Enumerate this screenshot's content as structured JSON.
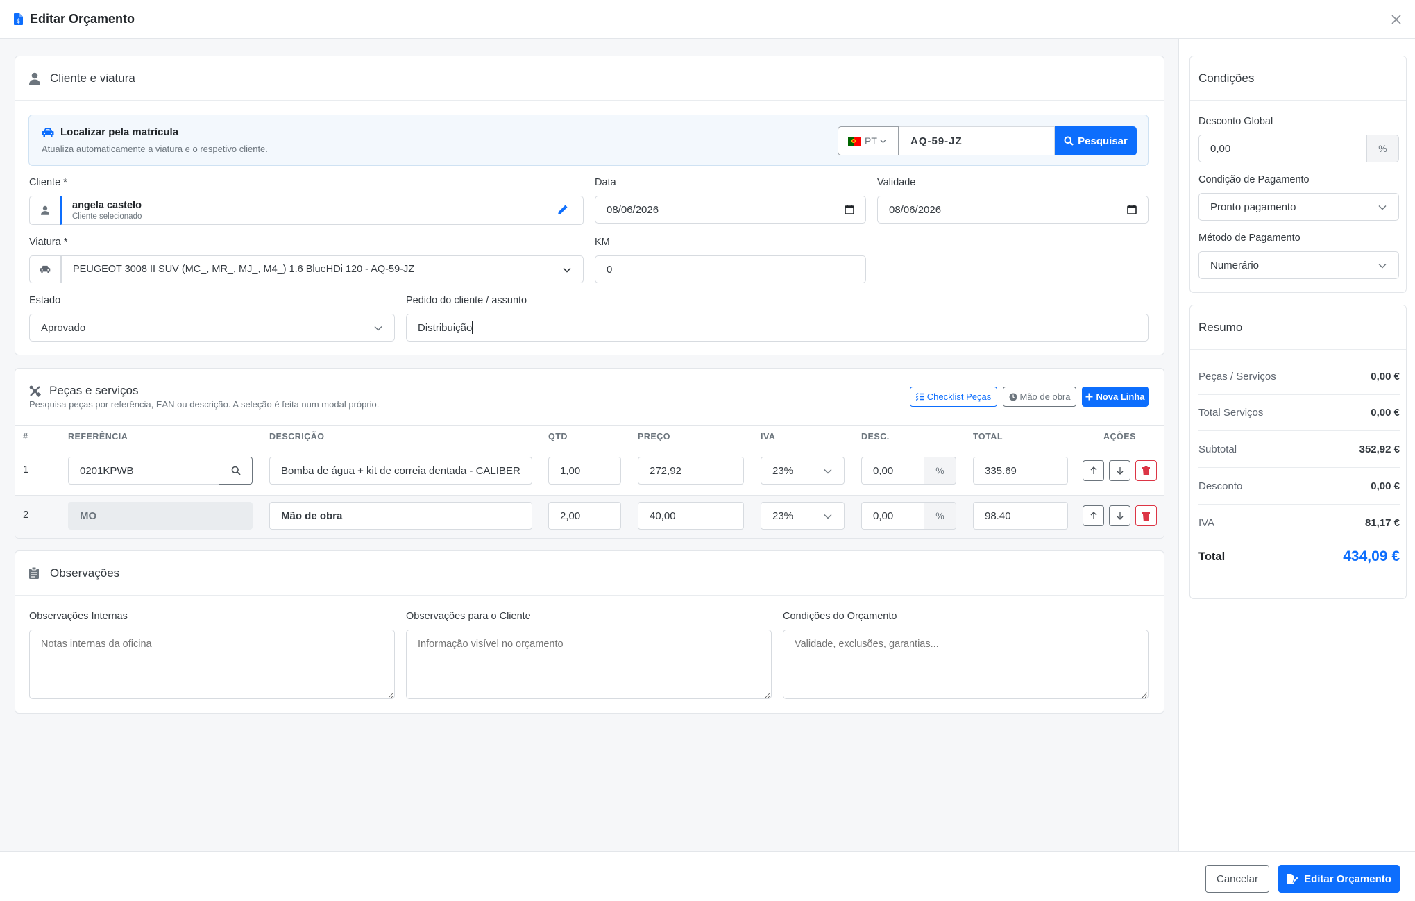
{
  "header": {
    "title": "Editar Orçamento"
  },
  "client_card": {
    "title": "Cliente e viatura",
    "plate_panel": {
      "title": "Localizar pela matrícula",
      "subtitle": "Atualiza automaticamente a viatura e o respetivo cliente.",
      "country": "PT",
      "plate": "AQ-59-JZ",
      "search_label": "Pesquisar"
    },
    "client_label": "Cliente *",
    "client_name": "angela castelo",
    "client_sub": "Cliente selecionado",
    "date_label": "Data",
    "date_value": "08/06/2026",
    "validity_label": "Validade",
    "validity_value": "08/06/2026",
    "vehicle_label": "Viatura *",
    "vehicle_value": "PEUGEOT 3008 II SUV (MC_, MR_, MJ_, M4_) 1.6 BlueHDi 120 - AQ-59-JZ",
    "km_label": "KM",
    "km_value": "0",
    "state_label": "Estado",
    "state_value": "Aprovado",
    "request_label": "Pedido do cliente / assunto",
    "request_value": "Distribuição"
  },
  "parts_card": {
    "title": "Peças e serviços",
    "subtitle": "Pesquisa peças por referência, EAN ou descrição. A seleção é feita num modal próprio.",
    "btn_checklist": "Checklist Peças",
    "btn_labor": "Mão de obra",
    "btn_new_line": "Nova Linha",
    "columns": [
      "#",
      "REFERÊNCIA",
      "DESCRIÇÃO",
      "QTD",
      "PREÇO",
      "IVA",
      "DESC.",
      "TOTAL",
      "AÇÕES"
    ],
    "rows": [
      {
        "num": "1",
        "ref": "0201KPWB",
        "desc": "Bomba de água + kit de correia dentada - CALIBER",
        "qty": "1,00",
        "price": "272,92",
        "vat": "23%",
        "disc": "0,00",
        "pct": "%",
        "total": "335.69"
      },
      {
        "num": "2",
        "ref": "MO",
        "desc": "Mão de obra",
        "qty": "2,00",
        "price": "40,00",
        "vat": "23%",
        "disc": "0,00",
        "pct": "%",
        "total": "98.40"
      }
    ]
  },
  "notes_card": {
    "title": "Observações",
    "internal_label": "Observações Internas",
    "internal_placeholder": "Notas internas da oficina",
    "client_label": "Observações para o Cliente",
    "client_placeholder": "Informação visível no orçamento",
    "conditions_label": "Condições do Orçamento",
    "conditions_placeholder": "Validade, exclusões, garantias..."
  },
  "conditions": {
    "title": "Condições",
    "discount_label": "Desconto Global",
    "discount_value": "0,00",
    "discount_unit": "%",
    "payment_cond_label": "Condição de Pagamento",
    "payment_cond_value": "Pronto pagamento",
    "payment_method_label": "Método de Pagamento",
    "payment_method_value": "Numerário"
  },
  "summary": {
    "title": "Resumo",
    "rows": [
      {
        "label": "Peças / Serviços",
        "value": "0,00 €"
      },
      {
        "label": "Total Serviços",
        "value": "0,00 €"
      },
      {
        "label": "Subtotal",
        "value": "352,92 €"
      },
      {
        "label": "Desconto",
        "value": "0,00 €"
      },
      {
        "label": "IVA",
        "value": "81,17 €"
      }
    ],
    "total_label": "Total",
    "total_value": "434,09 €",
    "accent": "#0d6efd"
  },
  "footer": {
    "cancel": "Cancelar",
    "submit": "Editar Orçamento"
  }
}
